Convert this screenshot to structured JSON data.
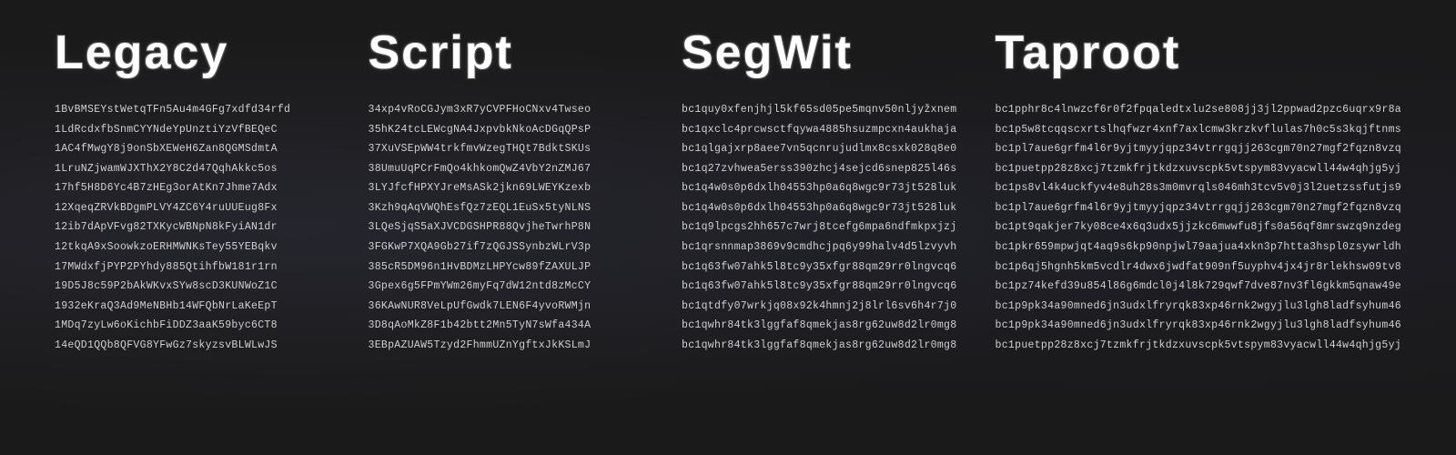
{
  "columns": [
    {
      "id": "legacy",
      "title": "Legacy",
      "addresses": [
        "1BvBMSEYstWetqTFn5Au4m4GFg7xdfd34rfd",
        "1LdRcdxfbSnmCYYNdeYpUnztiYzVfBEQeC",
        "1AC4fMwgY8j9onSbXEWeH6Zan8QGMSdmtA",
        "1LruNZjwamWJXThX2Y8C2d47QqhAkkc5os",
        "17hf5H8D6Yc4B7zHEg3orAtKn7Jhme7Adx",
        "12XqeqZRVkBDgmPLVY4ZC6Y4ruUUEug8Fx",
        "12ib7dApVFvg82TXKycWBNpN8kFyiAN1dr",
        "12tkqA9xSoowkzoERHMWNKsTey55YEBqkv",
        "17MWdxfjPYP2PYhdy885QtihfbW181r1rn",
        "19D5J8c59P2bAkWKvxSYw8scD3KUNWoZ1C",
        "1932eKraQ3Ad9MeNBHb14WFQbNrLaKeEpT",
        "1MDq7zyLw6oKichbFiDDZ3aaK59byc6CT8",
        "14eQD1QQb8QFVG8YFwGz7skyzsvBLWLwJS"
      ]
    },
    {
      "id": "script",
      "title": "Script",
      "addresses": [
        "34xp4vRoCGJym3xR7yCVPFHoCNxv4Twseo",
        "35hK24tcLEWcgNA4JxpvbkNkoAcDGqQPsP",
        "37XuVSEpWW4trkfmvWzegTHQt7BdktSKUs",
        "38UmuUqPCrFmQo4khkomQwZ4VbY2nZMJ67",
        "3LYJfcfHPXYJreMsASk2jkn69LWEYKzexb",
        "3Kzh9qAqVWQhEsfQz7zEQL1EuSx5tyNLNS",
        "3LQeSjqS5aXJVCDGSHPR88QvjheTwrhP8N",
        "3FGKwP7XQA9Gb27if7zQGJSSynbzWLrV3p",
        "385cR5DM96n1HvBDMzLHPYcw89fZAXULJP",
        "3Gpex6g5FPmYWm26myFq7dW12ntd8zMcCY",
        "36KAwNUR8VeLpUfGwdk7LEN6F4yvoRWMjn",
        "3D8qAoMkZ8F1b42btt2Mn5TyN7sWfa434A",
        "3EBpAZUAW5Tzyd2FhmmUZnYgftxJkKSLmJ"
      ]
    },
    {
      "id": "segwit",
      "title": "SegWit",
      "addresses": [
        "bc1quy0xfenjhjl5kf65sd05pe5mqnv50nljyžxnem",
        "bc1qxclc4prcwsctfqywa4885hsuzmpcxn4aukhaja",
        "bc1qlgajxrp8aee7vn5qcnrujudlmx8csxk028q8e0",
        "bc1q27zvhwea5erss390zhcj4sejcd6snep825l46s",
        "bc1q4w0s0p6dxlh04553hp0a6q8wgc9r73jt528luk",
        "bc1q4w0s0p6dxlh04553hp0a6q8wgc9r73jt528luk",
        "bc1q9lpcgs2hh657c7wrj8tcefg6mpa6ndfmkpxjzj",
        "bc1qrsnnmap3869v9cmdhcjpq6y99halv4d5lzvyvh",
        "bc1q63fw07ahk5l8tc9y35xfgr88qm29rr0lngvcq6",
        "bc1q63fw07ahk5l8tc9y35xfgr88qm29rr0lngvcq6",
        "bc1qtdfy07wrkjq08x92k4hmnj2j8lrl6sv6h4r7j0",
        "bc1qwhr84tk3lggfaf8qmekjas8rg62uw8d2lr0mg8",
        "bc1qwhr84tk3lggfaf8qmekjas8rg62uw8d2lr0mg8"
      ]
    },
    {
      "id": "taproot",
      "title": "Taproot",
      "addresses": [
        "bc1pphr8c4lnwzcf6r0f2fpqaledtxlu2se808jj3jl2ppwad2pzc6uqrx9r8a",
        "bc1p5w8tcqqscxrtslhqfwzr4xnf7axlcmw3krzkvflulas7h0c5s3kqjftnms",
        "bc1pl7aue6grfm4l6r9yjtmyyjqpz34vtrrgqjj263cgm70n27mgf2fqzn8vzq",
        "bc1puetpp28z8xcj7tzmkfrjtkdzxuvscpk5vtspym83vyacwll44w4qhjg5yj",
        "bc1ps8vl4k4uckfyv4e8uh28s3m0mvrqls046mh3tcv5v0j3l2uetzssfutjs9",
        "bc1pl7aue6grfm4l6r9yjtmyyjqpz34vtrrgqjj263cgm70n27mgf2fqzn8vzq",
        "bc1pt9qakjer7ky08ce4x6q3udx5jjzkc6mwwfu8jfs0a56qf8mrswzq9nzdeg",
        "bc1pkr659mpwjqt4aq9s6kp90npjwl79aajua4xkn3p7htta3hspl0zsywrldh",
        "bc1p6qj5hgnh5km5vcdlr4dwx6jwdfat909nf5uyphv4jx4jr8rlekhsw09tv8",
        "bc1pz74kefd39u854l86g6mdcl0j4l8k729qwf7dve87nv3fl6gkkm5qnaw49e",
        "bc1p9pk34a90mned6jn3udxlfryrqk83xp46rnk2wgyjlu3lgh8ladfsyhum46",
        "bc1p9pk34a90mned6jn3udxlfryrqk83xp46rnk2wgyjlu3lgh8ladfsyhum46",
        "bc1puetpp28z8xcj7tzmkfrjtkdzxuvscpk5vtspym83vyacwll44w4qhjg5yj"
      ]
    }
  ]
}
